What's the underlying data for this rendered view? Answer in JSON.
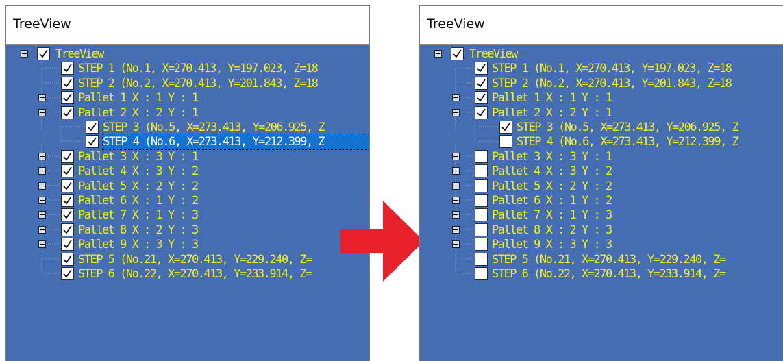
{
  "panels": {
    "before": {
      "title": "TreeView",
      "rows": [
        {
          "label": "TreeView",
          "level": 0,
          "expander": "minus",
          "checked": true
        },
        {
          "label": "STEP 1 (No.1, X=270.413, Y=197.023, Z=18",
          "level": 1,
          "checked": true
        },
        {
          "label": "STEP 2 (No.2, X=270.413, Y=201.843, Z=18",
          "level": 1,
          "checked": true
        },
        {
          "label": "Pallet 1 X : 1 Y : 1",
          "level": 1,
          "expander": "plus",
          "checked": true
        },
        {
          "label": "Pallet 2 X : 2 Y : 1",
          "level": 1,
          "expander": "minus",
          "checked": true
        },
        {
          "label": "STEP 3 (No.5, X=273.413, Y=206.925, Z",
          "level": 2,
          "checked": true
        },
        {
          "label": "STEP 4 (No.6, X=273.413, Y=212.399, Z",
          "level": 2,
          "checked": true,
          "selected": true
        },
        {
          "label": "Pallet 3 X : 3 Y : 1",
          "level": 1,
          "expander": "plus",
          "checked": true
        },
        {
          "label": "Pallet 4 X : 3 Y : 2",
          "level": 1,
          "expander": "plus",
          "checked": true
        },
        {
          "label": "Pallet 5 X : 2 Y : 2",
          "level": 1,
          "expander": "plus",
          "checked": true
        },
        {
          "label": "Pallet 6 X : 1 Y : 2",
          "level": 1,
          "expander": "plus",
          "checked": true
        },
        {
          "label": "Pallet 7 X : 1 Y : 3",
          "level": 1,
          "expander": "plus",
          "checked": true
        },
        {
          "label": "Pallet 8 X : 2 Y : 3",
          "level": 1,
          "expander": "plus",
          "checked": true
        },
        {
          "label": "Pallet 9 X : 3 Y : 3",
          "level": 1,
          "expander": "plus",
          "checked": true
        },
        {
          "label": "STEP 5 (No.21, X=270.413, Y=229.240, Z=",
          "level": 1,
          "checked": true
        },
        {
          "label": "STEP 6 (No.22, X=270.413, Y=233.914, Z=",
          "level": 1,
          "checked": true
        }
      ]
    },
    "after": {
      "title": "TreeView",
      "rows": [
        {
          "label": "TreeView",
          "level": 0,
          "expander": "minus",
          "checked": true
        },
        {
          "label": "STEP 1 (No.1, X=270.413, Y=197.023, Z=18",
          "level": 1,
          "checked": true
        },
        {
          "label": "STEP 2 (No.2, X=270.413, Y=201.843, Z=18",
          "level": 1,
          "checked": true
        },
        {
          "label": "Pallet 1 X : 1 Y : 1",
          "level": 1,
          "expander": "plus",
          "checked": true
        },
        {
          "label": "Pallet 2 X : 2 Y : 1",
          "level": 1,
          "expander": "minus",
          "checked": true
        },
        {
          "label": "STEP 3 (No.5, X=273.413, Y=206.925, Z",
          "level": 2,
          "checked": true
        },
        {
          "label": "STEP 4 (No.6, X=273.413, Y=212.399, Z",
          "level": 2,
          "checked": false
        },
        {
          "label": "Pallet 3 X : 3 Y : 1",
          "level": 1,
          "expander": "plus",
          "checked": false
        },
        {
          "label": "Pallet 4 X : 3 Y : 2",
          "level": 1,
          "expander": "plus",
          "checked": false
        },
        {
          "label": "Pallet 5 X : 2 Y : 2",
          "level": 1,
          "expander": "plus",
          "checked": false
        },
        {
          "label": "Pallet 6 X : 1 Y : 2",
          "level": 1,
          "expander": "plus",
          "checked": false
        },
        {
          "label": "Pallet 7 X : 1 Y : 3",
          "level": 1,
          "expander": "plus",
          "checked": false
        },
        {
          "label": "Pallet 8 X : 2 Y : 3",
          "level": 1,
          "expander": "plus",
          "checked": false
        },
        {
          "label": "Pallet 9 X : 3 Y : 3",
          "level": 1,
          "expander": "plus",
          "checked": false
        },
        {
          "label": "STEP 5 (No.21, X=270.413, Y=229.240, Z=",
          "level": 1,
          "checked": false
        },
        {
          "label": "STEP 6 (No.22, X=270.413, Y=233.914, Z=",
          "level": 1,
          "checked": false
        }
      ]
    }
  },
  "arrow": {
    "icon": "right-arrow-icon",
    "color": "#e8202a"
  },
  "colors": {
    "tree_background": "#456eb2",
    "item_text": "#f5ed1c",
    "selection": "#1472d0"
  }
}
